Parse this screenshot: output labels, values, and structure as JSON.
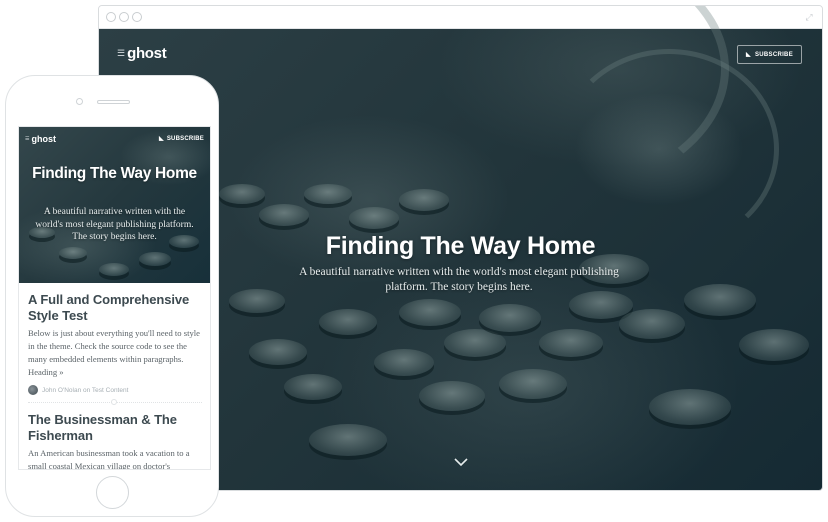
{
  "desktop": {
    "window_controls": [
      "close",
      "minimize",
      "maximize"
    ],
    "expand_icon": "expand-arrows-icon",
    "brand": {
      "mark_icon": "ghost-logo-icon",
      "name": "ghost"
    },
    "subscribe": {
      "icon": "rss-icon",
      "label": "SUBSCRIBE"
    },
    "hero": {
      "title": "Finding The Way Home",
      "description": "A beautiful narrative written with the world's most elegant publishing platform. The story begins here.",
      "scroll_icon": "chevron-down-icon"
    },
    "colors": {
      "overlay": "#1b3038",
      "text": "#ffffff"
    }
  },
  "mobile": {
    "brand": {
      "mark_icon": "ghost-logo-icon",
      "name": "ghost"
    },
    "subscribe": {
      "icon": "rss-icon",
      "label": "SUBSCRIBE"
    },
    "hero": {
      "title": "Finding The Way Home",
      "description": "A beautiful narrative written with the world's most elegant publishing platform. The story begins here."
    },
    "posts": [
      {
        "title": "A Full and Comprehensive Style Test",
        "excerpt": "Below is just about everything you'll need to style in the theme. Check the source code to see the many embedded elements within paragraphs. Heading »",
        "author": "John O'Nolan",
        "meta": "John O'Nolan on Test Content"
      },
      {
        "title": "The Businessman & The Fisherman",
        "excerpt": "An American businessman took a vacation to a small coastal Mexican village on doctor's"
      }
    ],
    "colors": {
      "post_title": "#3d4a50",
      "excerpt": "#5b6368",
      "meta": "#a7afb4"
    }
  }
}
